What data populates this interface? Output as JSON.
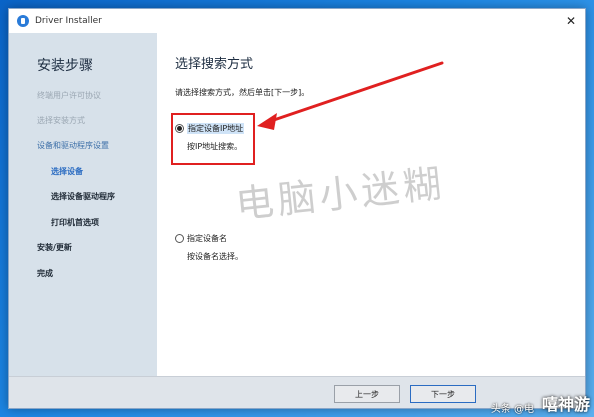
{
  "window": {
    "title": "Driver Installer",
    "close_glyph": "✕"
  },
  "sidebar": {
    "title": "安装步骤",
    "items": [
      {
        "label": "终端用户许可协议",
        "state": "done"
      },
      {
        "label": "选择安装方式",
        "state": "done"
      },
      {
        "label": "设备和驱动程序设置",
        "state": "current"
      },
      {
        "label": "选择设备",
        "state": "active"
      },
      {
        "label": "选择设备驱动程序",
        "state": "pending"
      },
      {
        "label": "打印机首选项",
        "state": "pending"
      },
      {
        "label": "安装/更新",
        "state": "pending"
      },
      {
        "label": "完成",
        "state": "pending"
      }
    ]
  },
  "main": {
    "title": "选择搜索方式",
    "instruction": "请选择搜索方式，然后单击[下一步]。",
    "options": [
      {
        "label": "指定设备IP地址",
        "description": "按IP地址搜索。",
        "checked": true
      },
      {
        "label": "指定设备名",
        "description": "按设备名选择。",
        "checked": false
      }
    ]
  },
  "footer": {
    "back_label": "上一步",
    "next_label": "下一步"
  },
  "overlay": {
    "watermark": "电脑小迷糊",
    "credit": "头条 @电",
    "logo_stamp": "嘻神游",
    "annotation_color": "#e02020"
  }
}
